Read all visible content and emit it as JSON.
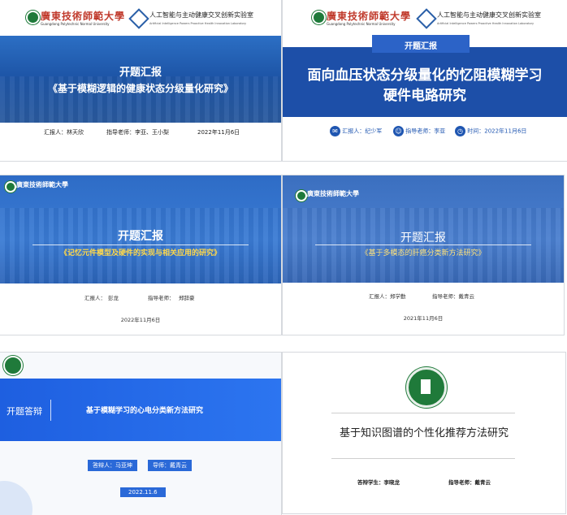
{
  "slides": [
    {
      "university": "廣東技術師範大學",
      "university_en": "Guangdong Polytechnic Normal University",
      "lab": "人工智能与主动健康交叉创新实验室",
      "lab_en": "Artificial Intelligence Powers Proactive Health Innovation Laboratory",
      "heading": "开题汇报",
      "title": "《基于模糊逻辑的健康状态分级量化研究》",
      "reporter": "汇报人：林天欣",
      "advisor": "指导老师：李亚、王小梨",
      "date": "2022年11月6日"
    },
    {
      "university": "廣東技術師範大學",
      "university_en": "Guangdong Polytechnic Normal University",
      "lab": "人工智能与主动健康交叉创新实验室",
      "lab_en": "Artificial Intelligence Powers Proactive Health Innovation Laboratory",
      "tag": "开题汇报",
      "title_line1": "面向血压状态分级量化的忆阻模糊学习",
      "title_line2": "硬件电路研究",
      "reporter": "汇报人：纪少军",
      "advisor": "指导老师：李亚",
      "date": "时间：2022年11月6日"
    },
    {
      "university": "廣東技術師範大學",
      "heading": "开题汇报",
      "title": "《记忆元件模型及硬件的实现与相关应用的研究》",
      "reporter_label": "汇报人：",
      "reporter_name": "彭龙",
      "advisor_label": "指导老师：",
      "advisor_name": "郑辞豪",
      "date": "2022年11月6日"
    },
    {
      "university": "廣東技術師範大學",
      "heading": "开题汇报",
      "title": "《基于多模态的肝癌分类新方法研究》",
      "reporter": "汇报人：郑学勤",
      "advisor": "指导老师：戴青云",
      "date": "2021年11月6日"
    },
    {
      "heading": "开题答辩",
      "title": "基于模糊学习的心电分类新方法研究",
      "reporter": "答辩人：马亚坤",
      "advisor": "导师：戴青云",
      "date": "2022.11.6"
    },
    {
      "title": "基于知识图谱的个性化推荐方法研究",
      "student": "答辩学生：李晓龙",
      "advisor": "指导老师：戴青云"
    }
  ]
}
